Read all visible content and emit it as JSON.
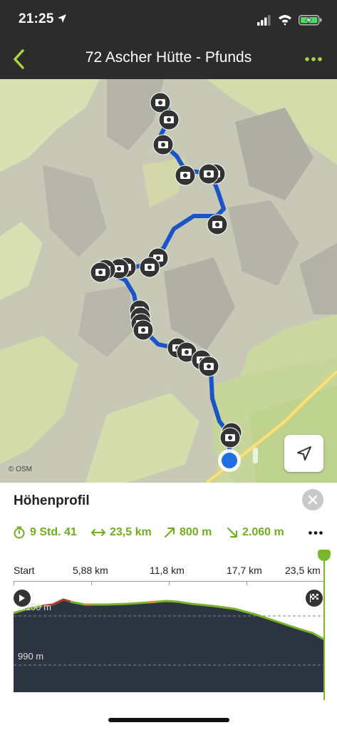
{
  "status": {
    "time": "21:25",
    "icons": [
      "location-arrow-icon",
      "signal-icon",
      "wifi-icon",
      "battery-charging-icon"
    ]
  },
  "nav": {
    "title": "72 Ascher Hütte - Pfunds",
    "back_icon": "chevron-left-icon",
    "more_icon": "more-dots-icon"
  },
  "map": {
    "attribution": "© OSM",
    "locate_icon": "navigation-arrow-icon",
    "route_color": "#1a55c8",
    "location_color": "#1f6fe0"
  },
  "panel": {
    "title": "Höhenprofil",
    "close_icon": "close-icon",
    "stats": {
      "duration": "9 Std. 41",
      "distance": "23,5 km",
      "ascent": "800 m",
      "descent": "2.060 m"
    },
    "axis_labels": [
      "Start",
      "5,88 km",
      "11,8 km",
      "17,7 km",
      "23,5 km"
    ],
    "elevation_labels": [
      "2.150 m",
      "990 m"
    ],
    "accent_color": "#6fae1f"
  }
}
